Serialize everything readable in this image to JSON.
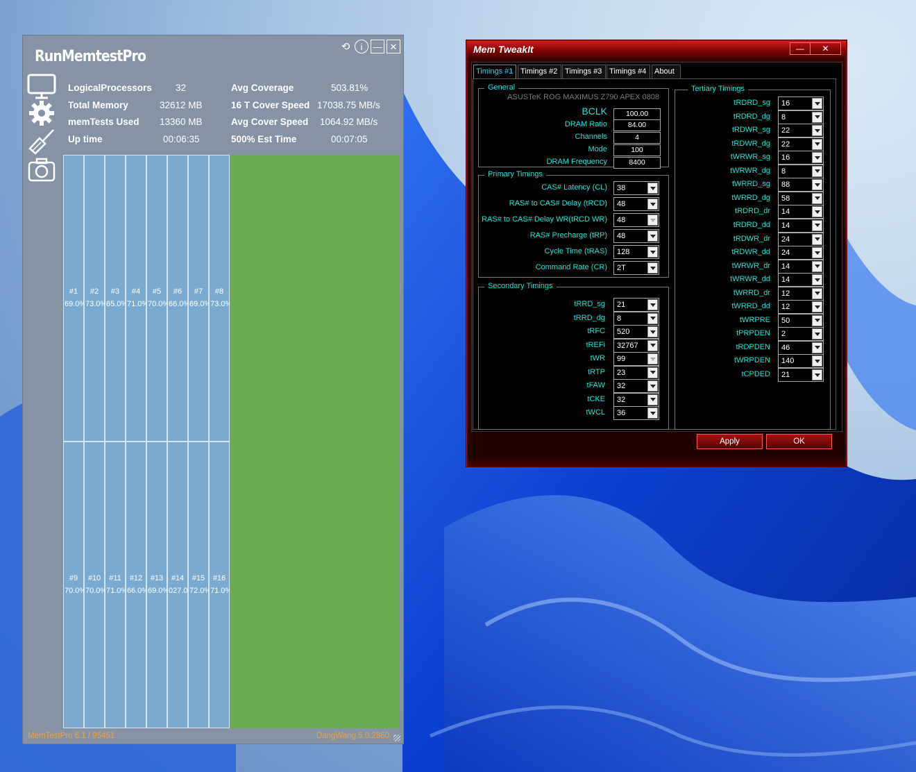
{
  "runmemtest": {
    "title": "RunMemtestPro",
    "stats": [
      {
        "label": "LogicalProcessors",
        "value": "32"
      },
      {
        "label": "Total Memory",
        "value": "32612 MB"
      },
      {
        "label": "memTests Used",
        "value": "13360 MB"
      },
      {
        "label": "Up time",
        "value": "00:06:35"
      }
    ],
    "stats_right": [
      {
        "label": "Avg Coverage",
        "value": "503.81%"
      },
      {
        "label": "16 T Cover Speed",
        "value": "17038.75 MB/s"
      },
      {
        "label": "Avg Cover Speed",
        "value": "1064.92 MB/s"
      },
      {
        "label": "500% Est Time",
        "value": "00:07:05"
      }
    ],
    "threads": [
      {
        "num": "#1",
        "pct": "69.0%"
      },
      {
        "num": "#2",
        "pct": "73.0%"
      },
      {
        "num": "#3",
        "pct": "65.0%"
      },
      {
        "num": "#4",
        "pct": "71.0%"
      },
      {
        "num": "#5",
        "pct": "70.0%"
      },
      {
        "num": "#6",
        "pct": "66.0%"
      },
      {
        "num": "#7",
        "pct": "69.0%"
      },
      {
        "num": "#8",
        "pct": "73.0%"
      },
      {
        "num": "#9",
        "pct": "70.0%"
      },
      {
        "num": "#10",
        "pct": "70.0%"
      },
      {
        "num": "#11",
        "pct": "71.0%"
      },
      {
        "num": "#12",
        "pct": "66.0%"
      },
      {
        "num": "#13",
        "pct": "69.0%"
      },
      {
        "num": "#14",
        "pct": "027.0"
      },
      {
        "num": "#15",
        "pct": "72.0%"
      },
      {
        "num": "#16",
        "pct": "71.0%"
      }
    ],
    "footer_left": "MemTestPro 6.1 / 95451",
    "footer_right": "DangWang 5.0.2860",
    "colors": {
      "done": "#7baad0",
      "coverage": "#6bab55",
      "footer": "#f3a23b"
    }
  },
  "tweakit": {
    "title": "Mem TweakIt",
    "tabs": [
      "Timings #1",
      "Timings #2",
      "Timings #3",
      "Timings #4",
      "About"
    ],
    "general": {
      "legend": "General",
      "board": "ASUSTeK ROG MAXIMUS Z790 APEX 0808",
      "rows": [
        {
          "label": "BCLK",
          "value": "100.00"
        },
        {
          "label": "DRAM Ratio",
          "value": "84.00"
        },
        {
          "label": "Channels",
          "value": "4"
        },
        {
          "label": "Mode",
          "value": "100"
        },
        {
          "label": "DRAM Frequency",
          "value": "8400"
        }
      ]
    },
    "primary": {
      "legend": "Primary Timings",
      "rows": [
        {
          "label": "CAS# Latency (CL)",
          "value": "38"
        },
        {
          "label": "RAS# to CAS# Delay (tRCD)",
          "value": "48"
        },
        {
          "label": "RAS# to CAS# Delay WR(tRCD WR)",
          "value": "48"
        },
        {
          "label": "RAS# Precharge (tRP)",
          "value": "48"
        },
        {
          "label": "Cycle Time (tRAS)",
          "value": "128"
        },
        {
          "label": "Command Rate (CR)",
          "value": "2T"
        }
      ]
    },
    "secondary": {
      "legend": "Secondary Timings",
      "rows": [
        {
          "label": "tRRD_sg",
          "value": "21"
        },
        {
          "label": "tRRD_dg",
          "value": "8"
        },
        {
          "label": "tRFC",
          "value": "520"
        },
        {
          "label": "tREFi",
          "value": "32767"
        },
        {
          "label": "tWR",
          "value": "99"
        },
        {
          "label": "tRTP",
          "value": "23"
        },
        {
          "label": "tFAW",
          "value": "32"
        },
        {
          "label": "tCKE",
          "value": "32"
        },
        {
          "label": "tWCL",
          "value": "36"
        }
      ]
    },
    "tertiary": {
      "legend": "Tertiary Timings",
      "rows": [
        {
          "label": "tRDRD_sg",
          "value": "16"
        },
        {
          "label": "tRDRD_dg",
          "value": "8"
        },
        {
          "label": "tRDWR_sg",
          "value": "22"
        },
        {
          "label": "tRDWR_dg",
          "value": "22"
        },
        {
          "label": "tWRWR_sg",
          "value": "16"
        },
        {
          "label": "tWRWR_dg",
          "value": "8"
        },
        {
          "label": "tWRRD_sg",
          "value": "88"
        },
        {
          "label": "tWRRD_dg",
          "value": "58"
        },
        {
          "label": "tRDRD_dr",
          "value": "14"
        },
        {
          "label": "tRDRD_dd",
          "value": "14"
        },
        {
          "label": "tRDWR_dr",
          "value": "24"
        },
        {
          "label": "tRDWR_dd",
          "value": "24"
        },
        {
          "label": "tWRWR_dr",
          "value": "14"
        },
        {
          "label": "tWRWR_dd",
          "value": "14"
        },
        {
          "label": "tWRRD_dr",
          "value": "12"
        },
        {
          "label": "tWRRD_dd",
          "value": "12"
        },
        {
          "label": "tWRPRE",
          "value": "50"
        },
        {
          "label": "tPRPDEN",
          "value": "2"
        },
        {
          "label": "tRDPDEN",
          "value": "46"
        },
        {
          "label": "tWRPDEN",
          "value": "140"
        },
        {
          "label": "tCPDED",
          "value": "21"
        }
      ]
    },
    "apply_label": "Apply",
    "ok_label": "OK",
    "minimize_glyph": "—",
    "close_glyph": "✕"
  }
}
